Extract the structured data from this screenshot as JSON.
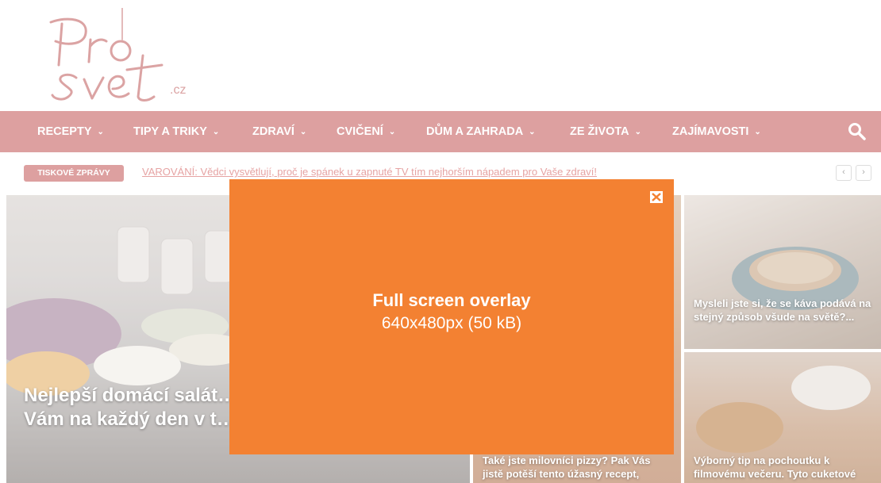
{
  "logo": {
    "alt": "Prosvet.cz",
    "line1": "Pro",
    "line2": "svet",
    "tld": ".cz"
  },
  "nav": {
    "items": [
      {
        "label": "RECEPTY"
      },
      {
        "label": "TIPY A TRIKY"
      },
      {
        "label": "ZDRAVÍ"
      },
      {
        "label": "CVIČENÍ"
      },
      {
        "label": "DŮM A ZAHRADA"
      },
      {
        "label": "ZE ŽIVOTA"
      },
      {
        "label": "ZAJÍMAVOSTI"
      }
    ],
    "chevron": "⌄",
    "search_icon": "search-icon"
  },
  "ticker": {
    "badge": "TISKOVÉ ZPRÁVY",
    "text": "VAROVÁNÍ: Vědci vysvětlují, proč je spánek u zapnuté TV tím nejhorším nápadem pro Vaše zdraví!",
    "prev": "‹",
    "next": "›"
  },
  "tiles": [
    {
      "title": "Nejlepší domácí salát… Připravte si ho v nede… Vám na každý den v t… zeleninu..."
    },
    {
      "title": "Také jste milovníci pizzy? Pak Vás jistě potěší tento úžasný recept,"
    },
    {
      "title": "Mysleli jste si, že se káva podává na stejný způsob všude na světě?..."
    },
    {
      "title": "Výborný tip na pochoutku k filmovému večeru. Tyto cuketové"
    }
  ],
  "overlay": {
    "title": "Full screen overlay",
    "subtitle": "640x480px (50 kB)",
    "close_icon": "close-icon",
    "bg": "#f38132"
  },
  "colors": {
    "nav": "#dda0a0",
    "overlay": "#f38132"
  }
}
